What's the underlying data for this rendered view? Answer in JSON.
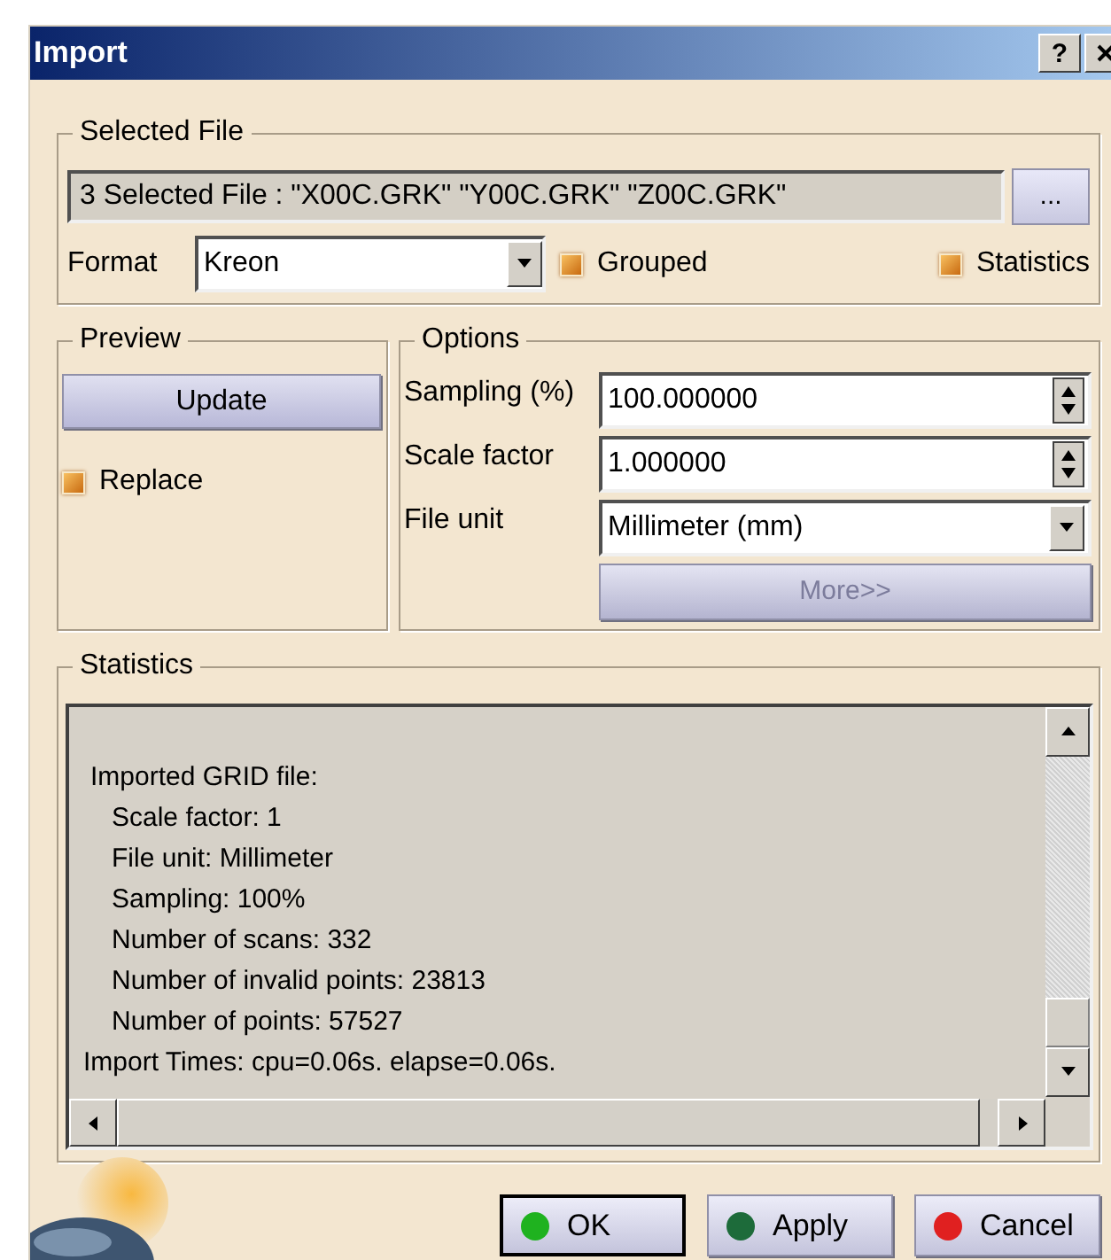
{
  "window": {
    "title": "Import",
    "help_button": "?"
  },
  "selected_file": {
    "legend": "Selected File",
    "value": "3 Selected File : \"X00C.GRK\" \"Y00C.GRK\" \"Z00C.GRK\"",
    "browse_button": "...",
    "format_label": "Format",
    "format_value": "Kreon",
    "checkboxes": [
      {
        "label": "Grouped",
        "checked": true
      },
      {
        "label": "Statistics",
        "checked": true
      }
    ]
  },
  "preview": {
    "legend": "Preview",
    "update_button": "Update",
    "replace": {
      "label": "Replace",
      "checked": true
    }
  },
  "options": {
    "legend": "Options",
    "fields": [
      {
        "kind": "spin",
        "label": "Sampling (%)",
        "value": "100.000000"
      },
      {
        "kind": "spin",
        "label": "Scale factor",
        "value": "1.000000"
      },
      {
        "kind": "combo",
        "label": "File unit",
        "value": "Millimeter (mm)"
      }
    ],
    "more_button": {
      "label": "More>>",
      "disabled": true
    }
  },
  "statistics": {
    "legend": "Statistics",
    "lines": [
      {
        "text": "Imported GRID file:",
        "children": [
          {
            "text": "Scale factor: 1"
          },
          {
            "text": "File unit: Millimeter"
          },
          {
            "text": "Sampling: 100%"
          },
          {
            "text": "Number of scans: 332"
          },
          {
            "text": "Number of invalid points: 23813"
          },
          {
            "text": "Number of points: 57527"
          }
        ]
      },
      {
        "text": "Import Times: cpu=0.06s. elapse=0.06s."
      }
    ]
  },
  "buttons": [
    {
      "label": "OK",
      "default": true,
      "color": "#1fb21f"
    },
    {
      "label": "Apply",
      "default": false,
      "color": "#1d6b3a"
    },
    {
      "label": "Cancel",
      "default": false,
      "color": "#e02020"
    }
  ]
}
